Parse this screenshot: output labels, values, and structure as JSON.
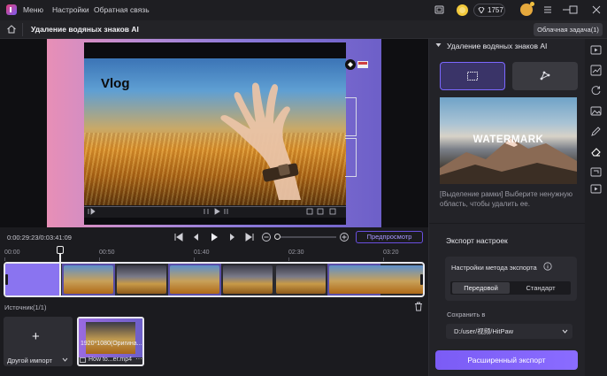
{
  "titlebar": {
    "menu_items": [
      "Меню",
      "Настройки",
      "Обратная связь"
    ],
    "credits": "1757"
  },
  "subheader": {
    "title": "Удаление водяных знаков AI",
    "cloud_task": "Облачная задача(1)"
  },
  "preview": {
    "video_text": "Vlog"
  },
  "transport": {
    "timecode": "0:00:29:23/0:03:41:09",
    "preview_button": "Предпросмотр"
  },
  "timeline": {
    "ticks": [
      "00:00",
      "00:50",
      "01:40",
      "02:30",
      "03:20"
    ]
  },
  "source": {
    "label": "Источник(1/1)",
    "import_label": "Другой импорт",
    "media_resolution": "1920*1080(Оригина...",
    "media_name": "How to...er.mp4"
  },
  "right_panel": {
    "title": "Удаление водяных знаков AI",
    "watermark_word": "WATERMARK",
    "hint": "[Выделение рамки] Выберите ненужную область, чтобы удалить ее.",
    "export_settings": "Экспорт настроек",
    "method_label": "Настройки метода экспорта",
    "method_options": [
      "Передовой",
      "Стандарт"
    ],
    "save_label": "Сохранить в",
    "save_path": "D:/user/视频/HitPaw",
    "export_button": "Расширенный экспорт"
  },
  "colors": {
    "accent": "#7b5cf5",
    "panel": "#232328",
    "background": "#1b1b1f"
  }
}
